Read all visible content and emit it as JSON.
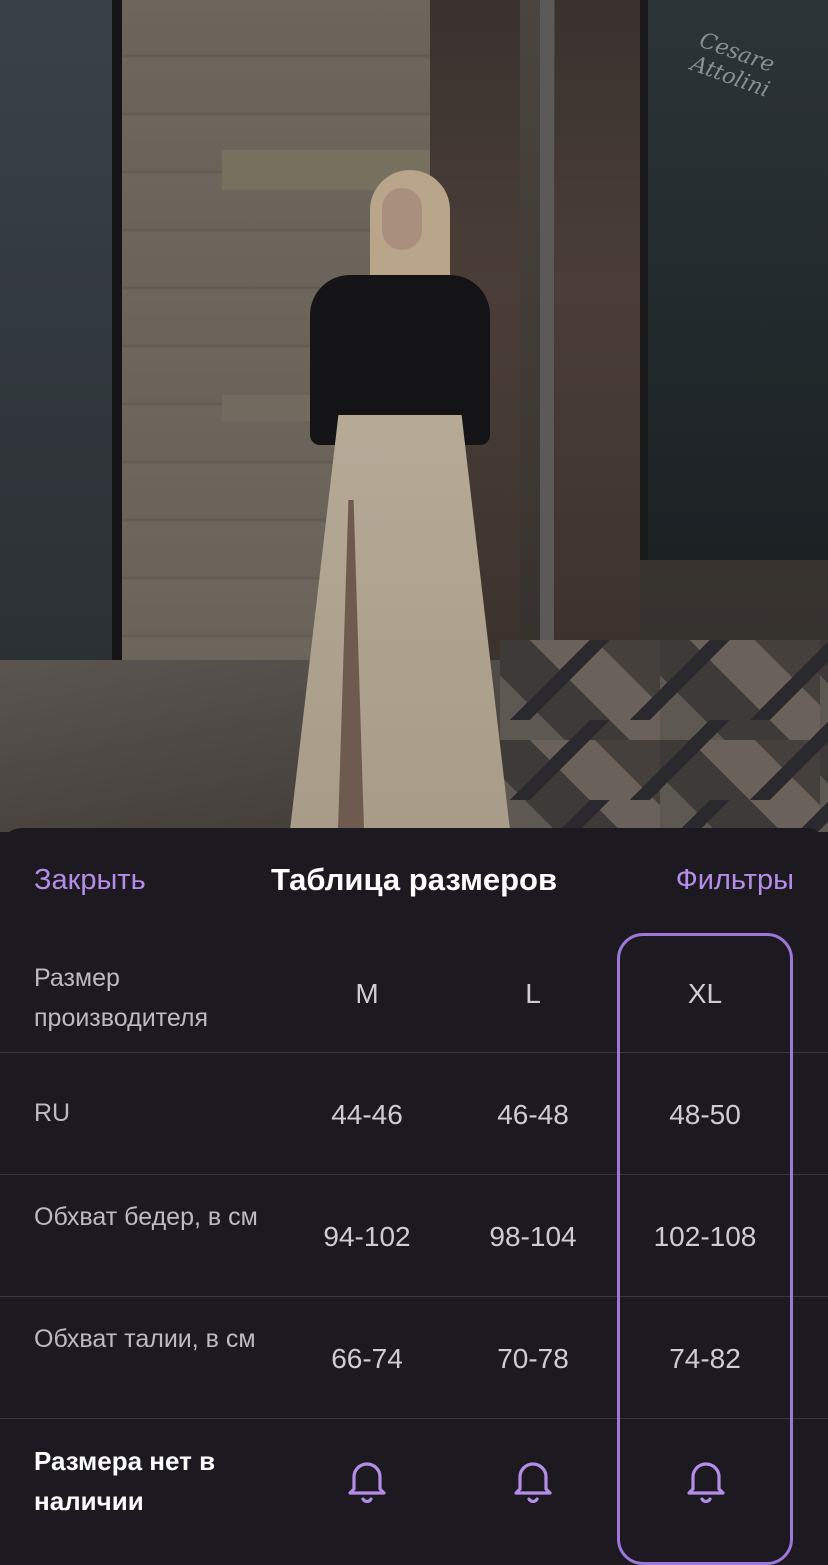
{
  "sheet": {
    "close_label": "Закрыть",
    "title": "Таблица размеров",
    "filters_label": "Фильтры",
    "accent_color": "#b48ee6",
    "background_color": "#1c1a20"
  },
  "size_table": {
    "header": {
      "label": "Размер производителя",
      "sizes": [
        "M",
        "L",
        "XL"
      ]
    },
    "rows": [
      {
        "label": "RU",
        "values": [
          "44-46",
          "46-48",
          "48-50"
        ]
      },
      {
        "label": "Обхват бедер, в см",
        "values": [
          "94-102",
          "98-104",
          "102-108"
        ]
      },
      {
        "label": "Обхват талии, в см",
        "values": [
          "66-74",
          "70-78",
          "74-82"
        ]
      }
    ],
    "availability": {
      "label": "Размера нет в наличии",
      "icons": [
        "bell-icon",
        "bell-icon",
        "bell-icon"
      ]
    },
    "selected_size": "XL"
  },
  "photo": {
    "shop_sign": "Cesare Attolini"
  }
}
